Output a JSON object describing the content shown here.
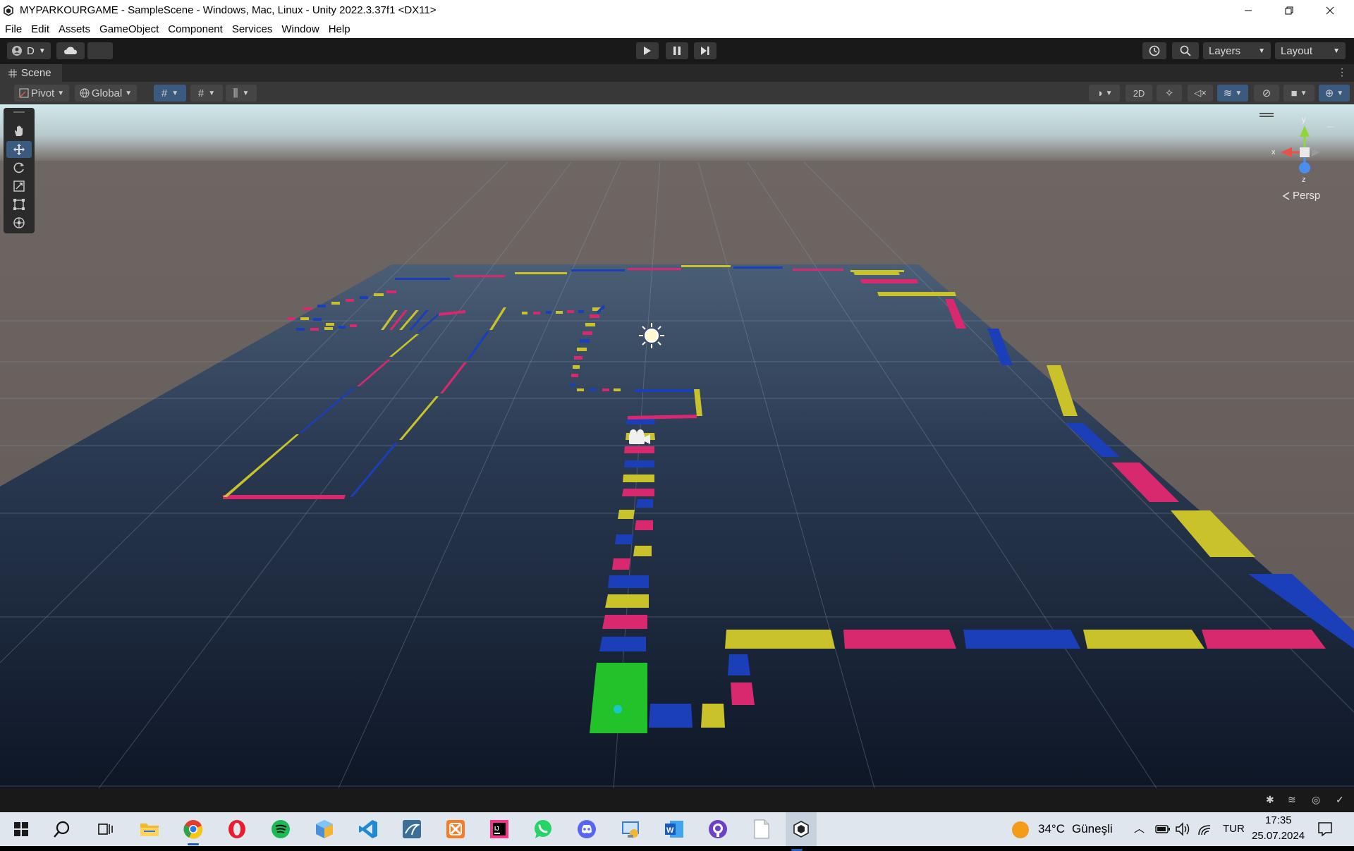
{
  "window": {
    "title": "MYPARKOURGAME - SampleScene - Windows, Mac, Linux - Unity 2022.3.37f1 <DX11>"
  },
  "menu": {
    "items": [
      {
        "label": "File"
      },
      {
        "label": "Edit"
      },
      {
        "label": "Assets"
      },
      {
        "label": "GameObject"
      },
      {
        "label": "Component"
      },
      {
        "label": "Services"
      },
      {
        "label": "Window"
      },
      {
        "label": "Help"
      }
    ]
  },
  "toolbar": {
    "account_label": "D",
    "layers_label": "Layers",
    "layout_label": "Layout"
  },
  "scene_tab": {
    "label": "Scene"
  },
  "scene_toolbar": {
    "pivot_label": "Pivot",
    "global_label": "Global",
    "view_2d_label": "2D"
  },
  "gizmo": {
    "x_label": "x",
    "y_label": "y",
    "z_label": "z",
    "persp_label": "Persp"
  },
  "taskbar": {
    "weather_temp": "34°C",
    "weather_desc": "Güneşli",
    "language": "TUR",
    "time": "17:35",
    "date": "25.07.2024"
  },
  "colors": {
    "accent": "#3a5a80",
    "pink": "#d8286e",
    "blue": "#1b3fb8",
    "yellow": "#c9c22a",
    "green": "#22c32a",
    "sky_top": "#cfe9ec",
    "ground": "#6b6360",
    "plane_far": "#4a5e76",
    "plane_near": "#0e1626"
  }
}
